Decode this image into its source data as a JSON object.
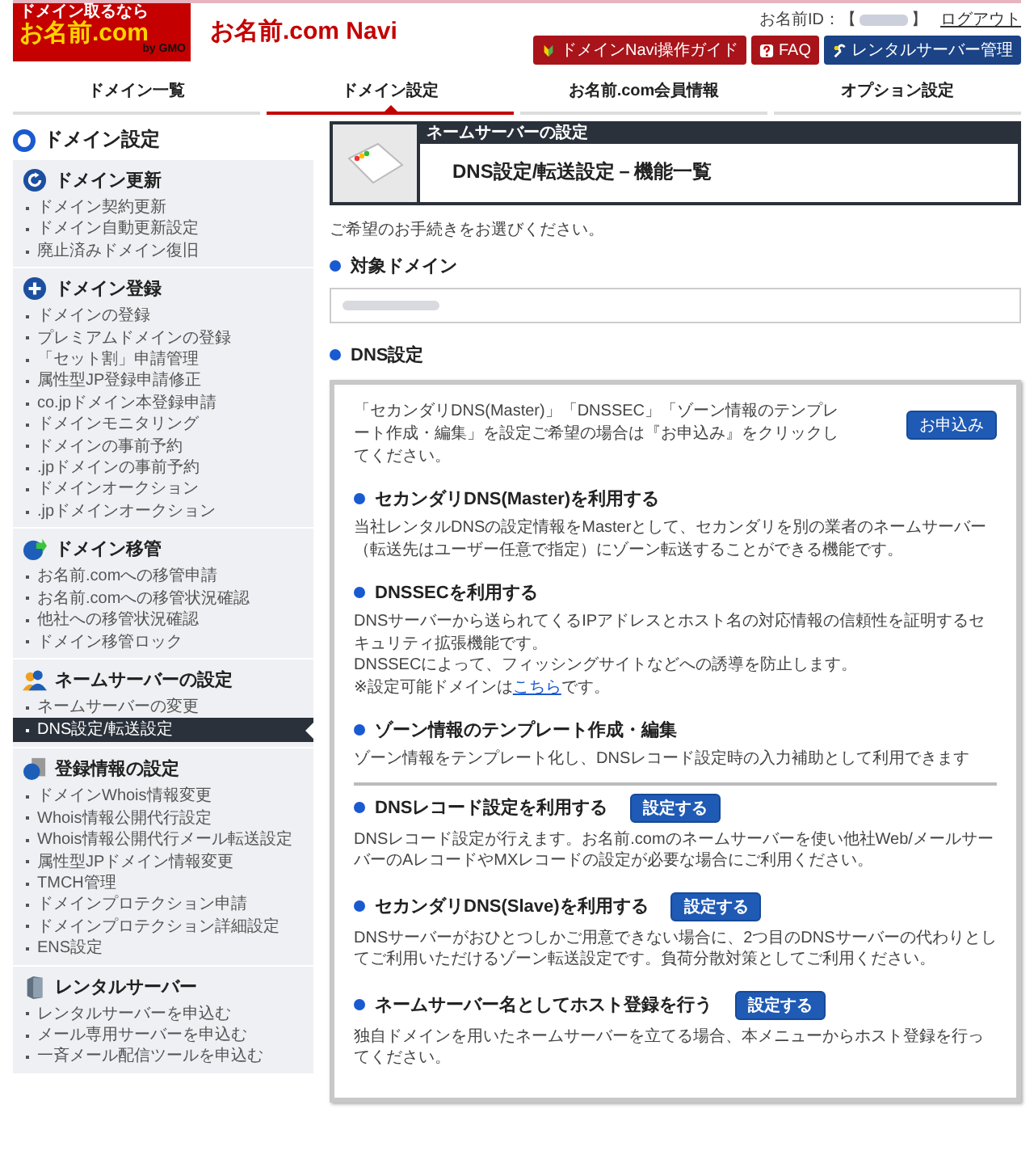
{
  "header": {
    "logo": {
      "tagline": "ドメイン取るなら",
      "name": "お名前.com",
      "suffix": "by GMO"
    },
    "title": "お名前.com Navi",
    "id_label": "お名前ID：【",
    "id_close": "】",
    "logout": "ログアウト",
    "buttons": [
      {
        "label": "ドメインNavi操作ガイド",
        "kind": "guide"
      },
      {
        "label": "FAQ",
        "kind": "faq"
      },
      {
        "label": "レンタルサーバー管理",
        "kind": "server"
      }
    ]
  },
  "tabs": [
    {
      "label": "ドメイン一覧",
      "selected": false
    },
    {
      "label": "ドメイン設定",
      "selected": true
    },
    {
      "label": "お名前.com会員情報",
      "selected": false
    },
    {
      "label": "オプション設定",
      "selected": false
    }
  ],
  "page_heading": "ドメイン設定",
  "sidebar": {
    "groups": [
      {
        "title": "ドメイン更新",
        "kind": "renew",
        "items": [
          {
            "label": "ドメイン契約更新",
            "selected": false
          },
          {
            "label": "ドメイン自動更新設定",
            "selected": false
          },
          {
            "label": "廃止済みドメイン復旧",
            "selected": false
          }
        ]
      },
      {
        "title": "ドメイン登録",
        "kind": "register",
        "items": [
          {
            "label": "ドメインの登録",
            "selected": false
          },
          {
            "label": "プレミアムドメインの登録",
            "selected": false
          },
          {
            "label": "「セット割」申請管理",
            "selected": false
          },
          {
            "label": "属性型JP登録申請修正",
            "selected": false
          },
          {
            "label": "co.jpドメイン本登録申請",
            "selected": false
          },
          {
            "label": "ドメインモニタリング",
            "selected": false
          },
          {
            "label": "ドメインの事前予約",
            "selected": false
          },
          {
            "label": ".jpドメインの事前予約",
            "selected": false
          },
          {
            "label": "ドメインオークション",
            "selected": false
          },
          {
            "label": ".jpドメインオークション",
            "selected": false
          }
        ]
      },
      {
        "title": "ドメイン移管",
        "kind": "transfer",
        "items": [
          {
            "label": "お名前.comへの移管申請",
            "selected": false
          },
          {
            "label": "お名前.comへの移管状況確認",
            "selected": false
          },
          {
            "label": "他社への移管状況確認",
            "selected": false
          },
          {
            "label": "ドメイン移管ロック",
            "selected": false
          }
        ]
      },
      {
        "title": "ネームサーバーの設定",
        "kind": "nameserver",
        "items": [
          {
            "label": "ネームサーバーの変更",
            "selected": false
          },
          {
            "label": "DNS設定/転送設定",
            "selected": true
          }
        ]
      },
      {
        "title": "登録情報の設定",
        "kind": "info",
        "items": [
          {
            "label": "ドメインWhois情報変更",
            "selected": false
          },
          {
            "label": "Whois情報公開代行設定",
            "selected": false
          },
          {
            "label": "Whois情報公開代行メール転送設定",
            "selected": false
          },
          {
            "label": "属性型JPドメイン情報変更",
            "selected": false
          },
          {
            "label": "TMCH管理",
            "selected": false
          },
          {
            "label": "ドメインプロテクション申請",
            "selected": false
          },
          {
            "label": "ドメインプロテクション詳細設定",
            "selected": false
          },
          {
            "label": "ENS設定",
            "selected": false
          }
        ]
      },
      {
        "title": "レンタルサーバー",
        "kind": "server",
        "items": [
          {
            "label": "レンタルサーバーを申込む",
            "selected": false
          },
          {
            "label": "メール専用サーバーを申込む",
            "selected": false
          },
          {
            "label": "一斉メール配信ツールを申込む",
            "selected": false
          }
        ]
      }
    ]
  },
  "main": {
    "banner": {
      "category": "ネームサーバーの設定",
      "title": "DNS設定/転送設定－機能一覧"
    },
    "intro": "ご希望のお手続きをお選びください。",
    "target_heading": "対象ドメイン",
    "dns_heading": "DNS設定",
    "notice": "「セカンダリDNS(Master)」「DNSSEC」「ゾーン情報のテンプレート作成・編集」を設定ご希望の場合は『お申込み』をクリックしてください。",
    "apply_button": "お申込み",
    "section_groups": [
      {
        "sections": [
          {
            "heading": "セカンダリDNS(Master)を利用する",
            "lines": [
              {
                "text": "当社レンタルDNSの設定情報をMasterとして、セカンダリを別の業者のネームサーバー（転送先はユーザー任意で指定）にゾーン転送することができる機能です。"
              }
            ]
          },
          {
            "heading": "DNSSECを利用する",
            "lines": [
              {
                "text": "DNSサーバーから送られてくるIPアドレスとホスト名の対応情報の信頼性を証明するセキュリティ拡張機能です。"
              },
              {
                "text": "DNSSECによって、フィッシングサイトなどへの誘導を防止します。"
              },
              {
                "text": "※設定可能ドメインは",
                "link": "こちら",
                "after": "です。"
              }
            ]
          },
          {
            "heading": "ゾーン情報のテンプレート作成・編集",
            "lines": [
              {
                "text": "ゾーン情報をテンプレート化し、DNSレコード設定時の入力補助として利用できます"
              }
            ]
          }
        ]
      },
      {
        "sections": [
          {
            "heading": "DNSレコード設定を利用する",
            "button": "設定する",
            "lines": [
              {
                "text": "DNSレコード設定が行えます。お名前.comのネームサーバーを使い他社Web/メールサーバーのAレコードやMXレコードの設定が必要な場合にご利用ください。"
              }
            ]
          },
          {
            "heading": "セカンダリDNS(Slave)を利用する",
            "button": "設定する",
            "lines": [
              {
                "text": "DNSサーバーがおひとつしかご用意できない場合に、2つ目のDNSサーバーの代わりとしてご利用いただけるゾーン転送設定です。負荷分散対策としてご利用ください。"
              }
            ]
          },
          {
            "heading": "ネームサーバー名としてホスト登録を行う",
            "button": "設定する",
            "lines": [
              {
                "text": "独自ドメインを用いたネームサーバーを立てる場合、本メニューからホスト登録を行ってください。"
              }
            ]
          }
        ]
      }
    ]
  }
}
